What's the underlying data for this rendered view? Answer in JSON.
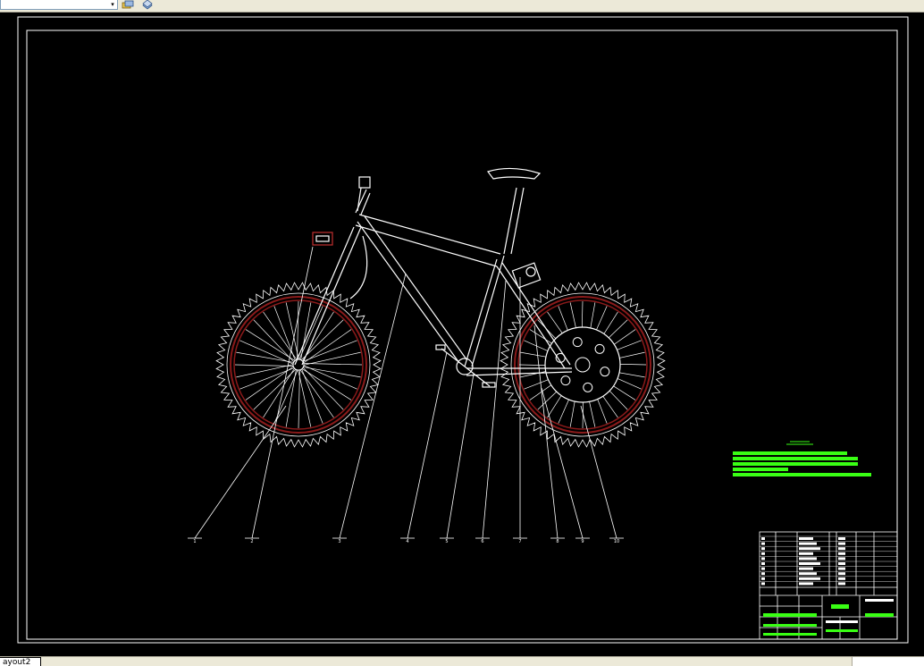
{
  "toolbar": {
    "layer_combo_value": "",
    "icons": [
      "layer-states-icon",
      "layer-previous-icon"
    ]
  },
  "drawing": {
    "background_color": "#000000",
    "line_color": "#ffffff",
    "rim_color": "#8b1a1a",
    "note_color": "#39ff14",
    "callout_labels": [
      "1",
      "2",
      "3",
      "4",
      "5",
      "6",
      "7",
      "8",
      "9",
      "10"
    ]
  },
  "layout_tabs": {
    "active_tab": "ayout2"
  }
}
